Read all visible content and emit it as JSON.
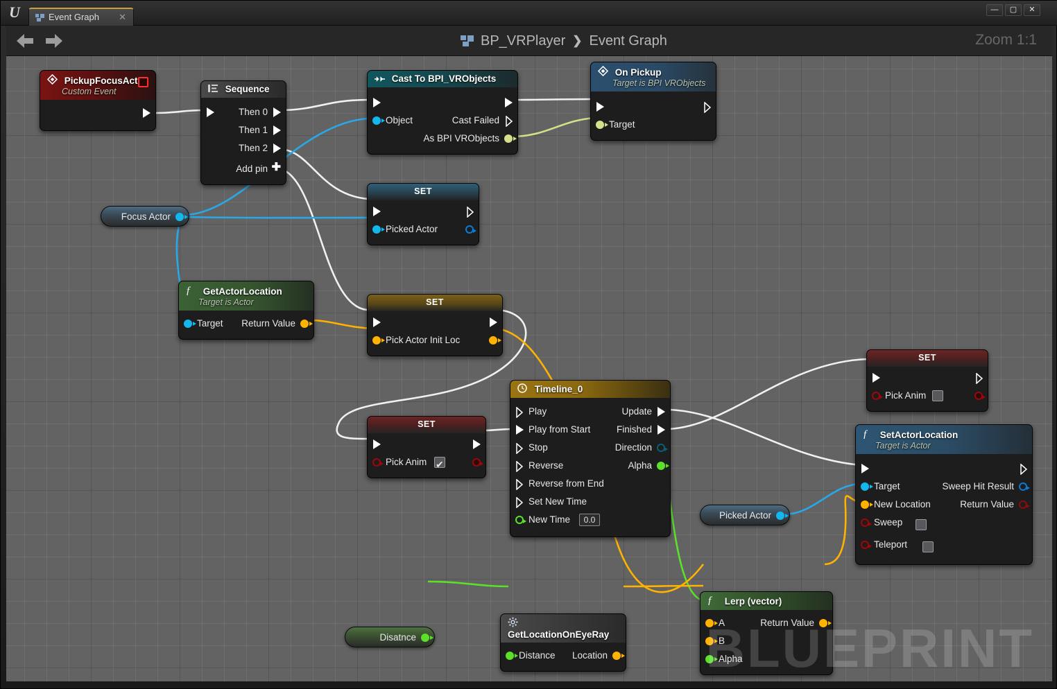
{
  "window": {
    "app_logo": "unreal-engine-logo",
    "tab_label": "Event Graph",
    "tab_close": "✕",
    "minimize": "―",
    "maximize": "▢",
    "close": "✕"
  },
  "toolbar": {
    "back_icon": "back-arrow",
    "forward_icon": "forward-arrow",
    "breadcrumb": {
      "icon": "blueprint-icon",
      "root": "BP_VRPlayer",
      "separator": "❯",
      "current": "Event Graph"
    },
    "zoom_label": "Zoom 1:1"
  },
  "canvas": {
    "watermark": "BLUEPRINT",
    "grid_color": "#636363"
  },
  "nodes": {
    "pickup_focus_actor": {
      "title": "PickupFocusActor",
      "subtitle": "Custom Event",
      "out_exec": ""
    },
    "sequence": {
      "title": "Sequence",
      "rows": [
        "Then 0",
        "Then 1",
        "Then 2"
      ],
      "add_pin": "Add pin"
    },
    "cast_to_bpi": {
      "title": "Cast To BPI_VRObjects",
      "in_object": "Object",
      "cast_failed": "Cast Failed",
      "as_bpi": "As BPI VRObjects"
    },
    "on_pickup": {
      "title": "On Pickup",
      "subtitle": "Target is BPI VRObjects",
      "target": "Target"
    },
    "focus_actor_var": {
      "label": "Focus Actor"
    },
    "set_picked_actor": {
      "title": "SET",
      "property": "Picked Actor"
    },
    "get_actor_location": {
      "title": "GetActorLocation",
      "subtitle": "Target is Actor",
      "target": "Target",
      "return_value": "Return Value"
    },
    "set_pick_actor_init_loc": {
      "title": "SET",
      "property": "Pick Actor Init Loc"
    },
    "set_pick_anim_on": {
      "title": "SET",
      "property": "Pick Anim",
      "value": true
    },
    "set_pick_anim_off": {
      "title": "SET",
      "property": "Pick Anim",
      "value": false
    },
    "timeline": {
      "title": "Timeline_0",
      "inputs": [
        "Play",
        "Play from Start",
        "Stop",
        "Reverse",
        "Reverse from End",
        "Set New Time"
      ],
      "new_time_label": "New Time",
      "new_time_value": "0.0",
      "outputs": [
        "Update",
        "Finished",
        "Direction",
        "Alpha"
      ]
    },
    "picked_actor_var": {
      "label": "Picked Actor"
    },
    "set_actor_location": {
      "title": "SetActorLocation",
      "subtitle": "Target is Actor",
      "inputs": [
        "Target",
        "New Location",
        "Sweep",
        "Teleport"
      ],
      "sweep_value": false,
      "teleport_value": false,
      "outputs": [
        "Sweep Hit Result",
        "Return Value"
      ]
    },
    "distance_var": {
      "label": "Disatnce"
    },
    "get_location_on_eye_ray": {
      "title": "GetLocationOnEyeRay",
      "input": "Distance",
      "output": "Location"
    },
    "lerp_vector": {
      "title": "Lerp (vector)",
      "inputs": [
        "A",
        "B",
        "Alpha"
      ],
      "output": "Return Value"
    }
  },
  "colors": {
    "exec_white": "#ffffff",
    "object_blue": "#12b7ee",
    "interface_yellowgreen": "#d6e08a",
    "vector_gold": "#ffb300",
    "bool_red": "#a00606",
    "float_green": "#5ce02a",
    "struct_darkblue": "#0a5e75",
    "accent_tab": "#c8a03c"
  }
}
